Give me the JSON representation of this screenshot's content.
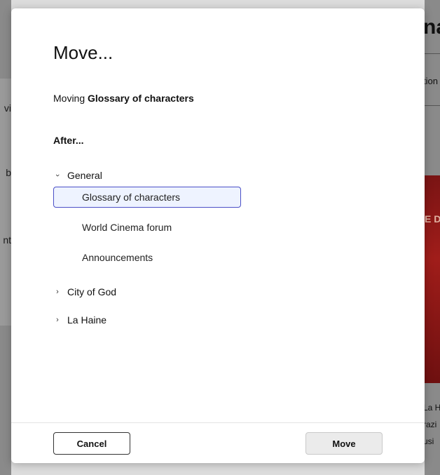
{
  "background": {
    "left_fragments": [
      "vi",
      "b",
      "nt"
    ],
    "right_title_fragment": "na",
    "right_tab_fragment": "tion",
    "right_image_fragment": "E D",
    "right_caption_fragments": [
      "La H",
      "razi",
      "usi"
    ]
  },
  "modal": {
    "title": "Move...",
    "moving_prefix": "Moving ",
    "moving_item": "Glossary of characters",
    "after_label": "After...",
    "tree": [
      {
        "label": "General",
        "expanded": true,
        "children": [
          {
            "label": "Glossary of characters",
            "selected": true
          },
          {
            "label": "World Cinema forum",
            "selected": false
          },
          {
            "label": "Announcements",
            "selected": false
          }
        ]
      },
      {
        "label": "City of God",
        "expanded": false
      },
      {
        "label": "La Haine",
        "expanded": false
      }
    ],
    "buttons": {
      "cancel": "Cancel",
      "move": "Move"
    }
  },
  "colors": {
    "selected_border": "#4a4fc7",
    "selected_background": "#eef3ff",
    "backdrop": "#6e6e6e"
  },
  "icons": {
    "expanded": "chevron-down-icon",
    "collapsed": "chevron-right-icon"
  }
}
